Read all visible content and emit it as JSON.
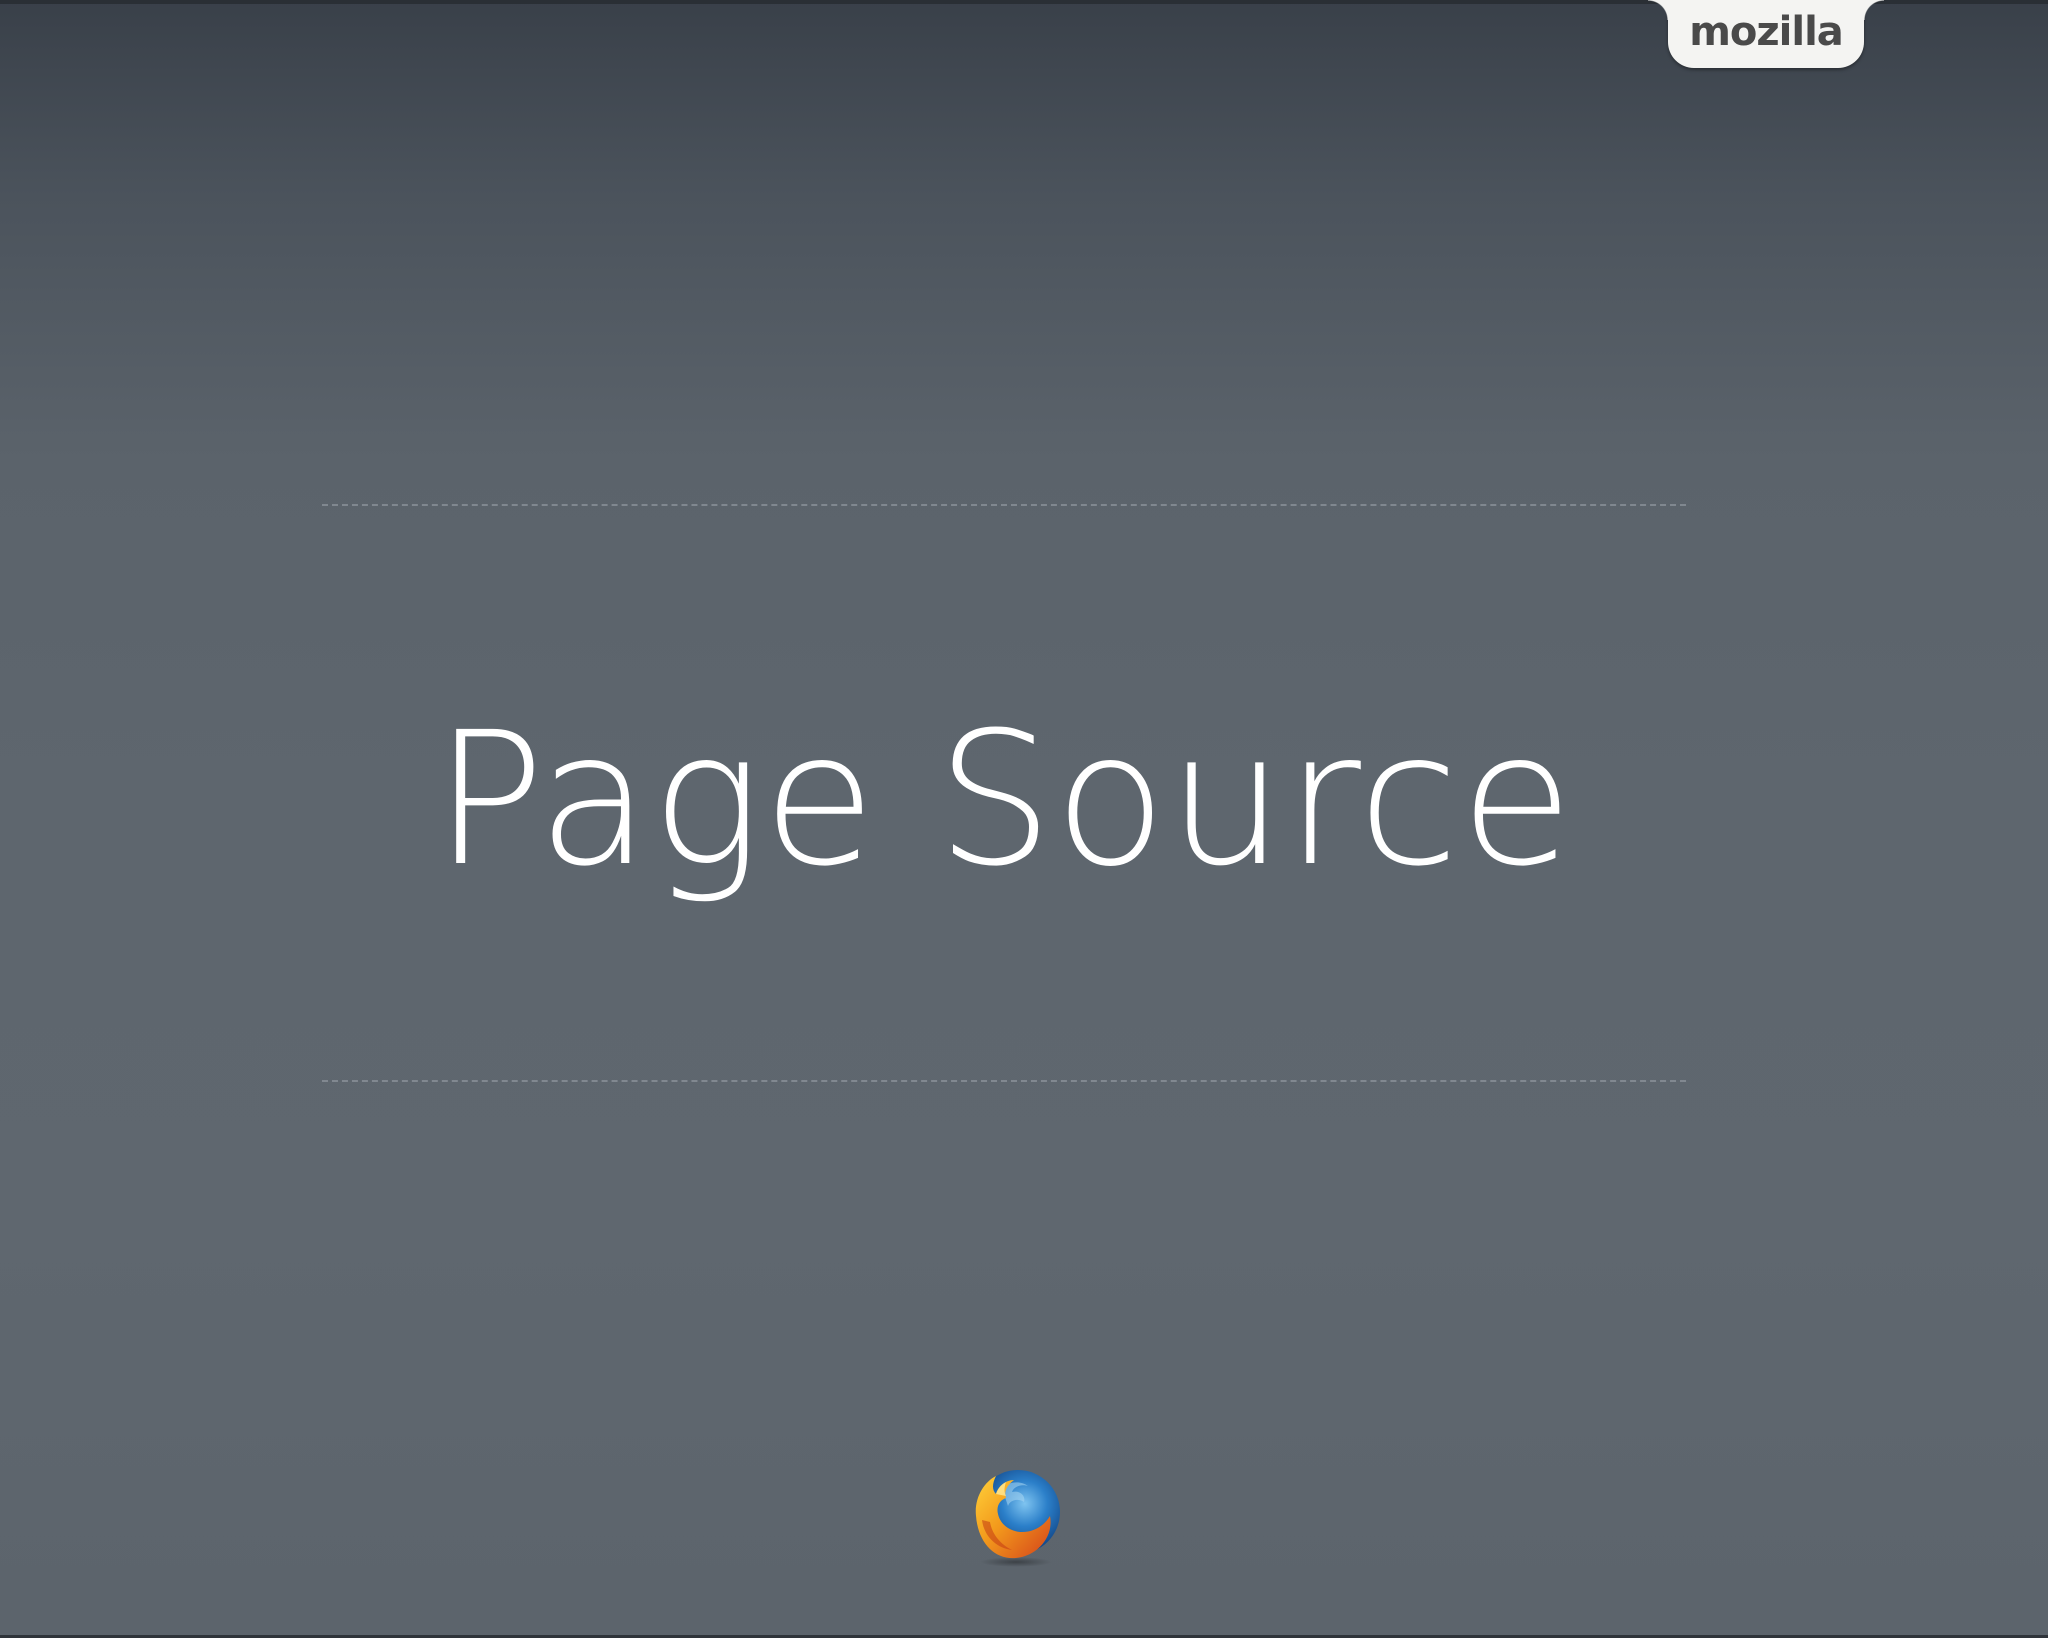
{
  "slide": {
    "title": "Page Source",
    "brand_tab": "mozilla"
  },
  "logo": {
    "icon": "firefox-logo-icon"
  },
  "colors": {
    "background": "#5e666e",
    "title": "#ffffff",
    "tab": "#f4f4f2",
    "tab_text": "#4a4a4a",
    "rule": "#8a9199"
  }
}
